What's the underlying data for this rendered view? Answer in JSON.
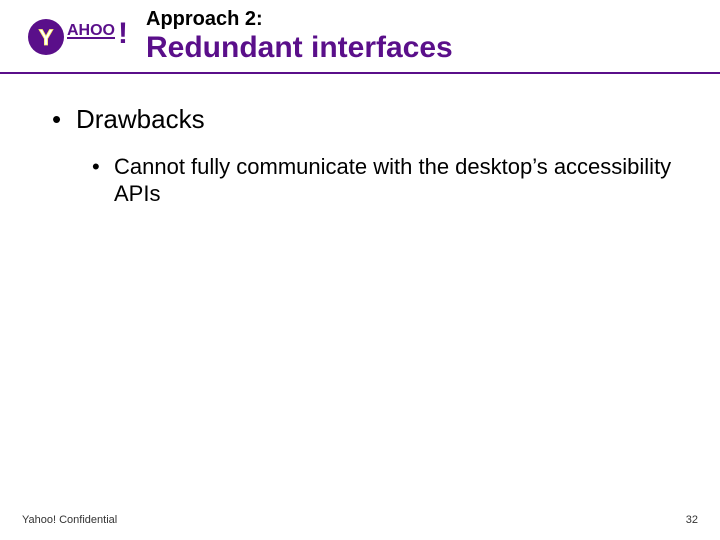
{
  "header": {
    "kicker": "Approach 2:",
    "title": "Redundant interfaces",
    "logo_alt": "Yahoo!"
  },
  "body": {
    "bullet1": "Drawbacks",
    "sub1": "Cannot fully communicate with the desktop’s accessibility APIs"
  },
  "footer": {
    "left": "Yahoo! Confidential",
    "page": "32"
  }
}
